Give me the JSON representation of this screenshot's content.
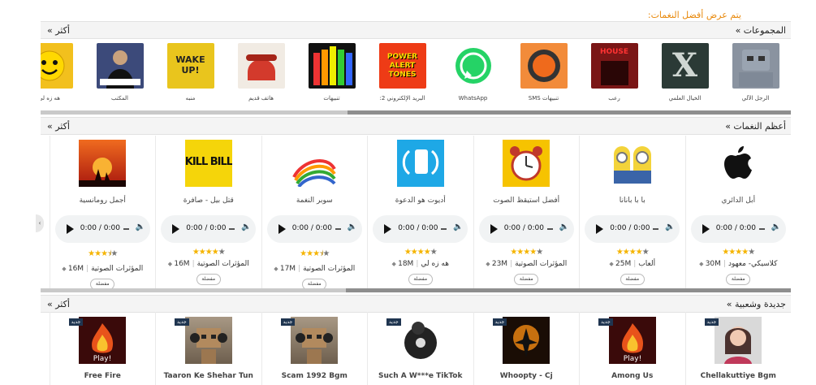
{
  "notice": "يتم عرض أفضل النغمات:",
  "categories_section": {
    "title": "المجموعات »",
    "more": "أكثر »",
    "items": [
      {
        "label": "الرجل الآلي",
        "icon": "robot-thumbnail-icon",
        "color": "#8a93a0"
      },
      {
        "label": "الخيال العلمي",
        "icon": "x-files-thumbnail-icon",
        "color": "#2b3a36"
      },
      {
        "label": "رعب",
        "icon": "horror-house-thumbnail-icon",
        "color": "#7a1616"
      },
      {
        "label": "تنبيهات SMS",
        "icon": "sms-orange-thumbnail-icon",
        "color": "#ef6a1c"
      },
      {
        "label": "WhatsApp",
        "icon": "whatsapp-thumbnail-icon",
        "color": "#25d366"
      },
      {
        "label": "البريد الإلكتروني 2:",
        "icon": "power-alert-thumbnail-icon",
        "color": "#ee3b16"
      },
      {
        "label": "تنبيهات",
        "icon": "colorful-bars-thumbnail-icon",
        "color": "#e9c21b"
      },
      {
        "label": "هاتف قديم",
        "icon": "old-phone-thumbnail-icon",
        "color": "#d33a2c"
      },
      {
        "label": "منبه",
        "icon": "wake-up-thumbnail-icon",
        "color": "#e9c51d"
      },
      {
        "label": "المكتب",
        "icon": "businessman-thumbnail-icon",
        "color": "#3c4a7a"
      },
      {
        "label": "هه زه لي",
        "icon": "smiley-faces-thumbnail-icon",
        "color": "#f2c01d"
      }
    ]
  },
  "top_section": {
    "title": "أعظم النغمات »",
    "more": "أكثر »",
    "fav_label": "مفضلة",
    "time": "0:00 / 0:00",
    "items": [
      {
        "title": "أبل الدائري",
        "size": "30M",
        "category": "كلاسيكي- معهود",
        "rating": 4,
        "icon": "apple-logo-icon",
        "color": "#ffffff"
      },
      {
        "title": "با با بانانا",
        "size": "25M",
        "category": "ألعاب",
        "rating": 4,
        "icon": "minions-thumbnail-icon",
        "color": "#f3d33a"
      },
      {
        "title": "أفضل استيقظ الصوت",
        "size": "23M",
        "category": "المؤثرات الصوتية",
        "rating": 4,
        "icon": "alarm-clock-thumbnail-icon",
        "color": "#f6c300"
      },
      {
        "title": "أديوت هو الدعوة",
        "size": "18M",
        "category": "هه زه لي",
        "rating": 4,
        "icon": "calling-phone-thumbnail-icon",
        "color": "#1ea8e6"
      },
      {
        "title": "سوبر النغمة",
        "size": "17M",
        "category": "المؤثرات الصوتية",
        "rating": 3.5,
        "icon": "rainbow-piano-thumbnail-icon",
        "color": "#ffffff"
      },
      {
        "title": "قتل بيل - صافرة",
        "size": "16M",
        "category": "المؤثرات الصوتية",
        "rating": 4,
        "icon": "kill-bill-thumbnail-icon",
        "color": "#f5d50a"
      },
      {
        "title": "أجمل رومانسية",
        "size": "16M",
        "category": "المؤثرات الصوتية",
        "rating": 3.5,
        "icon": "romantic-sunset-thumbnail-icon",
        "color": "#d3361c"
      }
    ]
  },
  "new_section": {
    "title": "جديدة وشعبية »",
    "more": "أكثر »",
    "badge": "جديد",
    "items": [
      {
        "title": "Chellakuttiye Bgm",
        "icon": "girl-headphones-thumbnail-icon",
        "color": "#d9d9d9"
      },
      {
        "title": "Among Us",
        "icon": "play-fire-thumbnail-icon",
        "color": "#3a0a0a"
      },
      {
        "title": "Whoopty - Cj",
        "icon": "fire-dancer-thumbnail-icon",
        "color": "#1a0d05"
      },
      {
        "title": "Such A W***e TikTok",
        "icon": "dj-turntable-thumbnail-icon",
        "color": "#ffffff"
      },
      {
        "title": "Scam 1992 Bgm",
        "icon": "robot-headphones-thumbnail-icon",
        "color": "#8b7a66"
      },
      {
        "title": "Taaron Ke Shehar Tun",
        "icon": "robot-headphones-thumbnail-icon",
        "color": "#8b7a66"
      },
      {
        "title": "Free Fire",
        "icon": "play-fire-thumbnail-icon",
        "color": "#3a0a0a"
      }
    ]
  }
}
